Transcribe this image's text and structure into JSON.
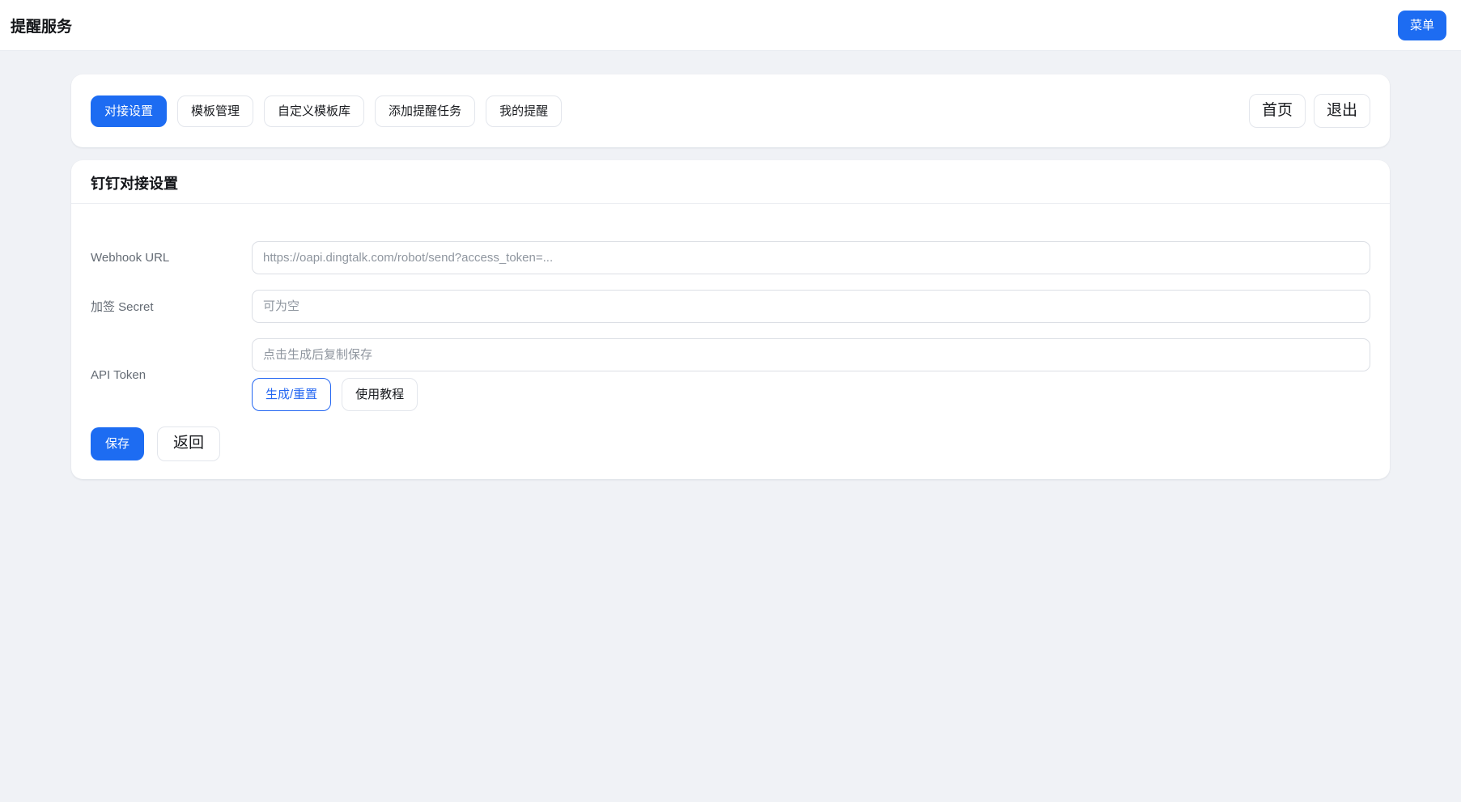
{
  "header": {
    "title": "提醒服务",
    "menu_button": "菜单"
  },
  "nav": {
    "tabs": [
      {
        "label": "对接设置",
        "active": true
      },
      {
        "label": "模板管理",
        "active": false
      },
      {
        "label": "自定义模板库",
        "active": false
      },
      {
        "label": "添加提醒任务",
        "active": false
      },
      {
        "label": "我的提醒",
        "active": false
      }
    ],
    "home_button": "首页",
    "exit_button": "退出"
  },
  "settings": {
    "title": "钉钉对接设置",
    "fields": [
      {
        "label": "Webhook URL",
        "value": "",
        "placeholder": "https://oapi.dingtalk.com/robot/send?access_token=..."
      },
      {
        "label": "加签 Secret",
        "value": "",
        "placeholder": "可为空"
      },
      {
        "label": "API Token",
        "value": "",
        "placeholder": "点击生成后复制保存"
      }
    ],
    "generate_button": "生成/重置",
    "tutorial_button": "使用教程",
    "save_button": "保存",
    "back_button": "返回"
  },
  "colors": {
    "accent": "#1d6cf2",
    "page_background": "#f0f2f6",
    "card_background": "#ffffff",
    "input_border": "#dcdfe5",
    "placeholder": "#8f969f",
    "label": "#646b74"
  }
}
